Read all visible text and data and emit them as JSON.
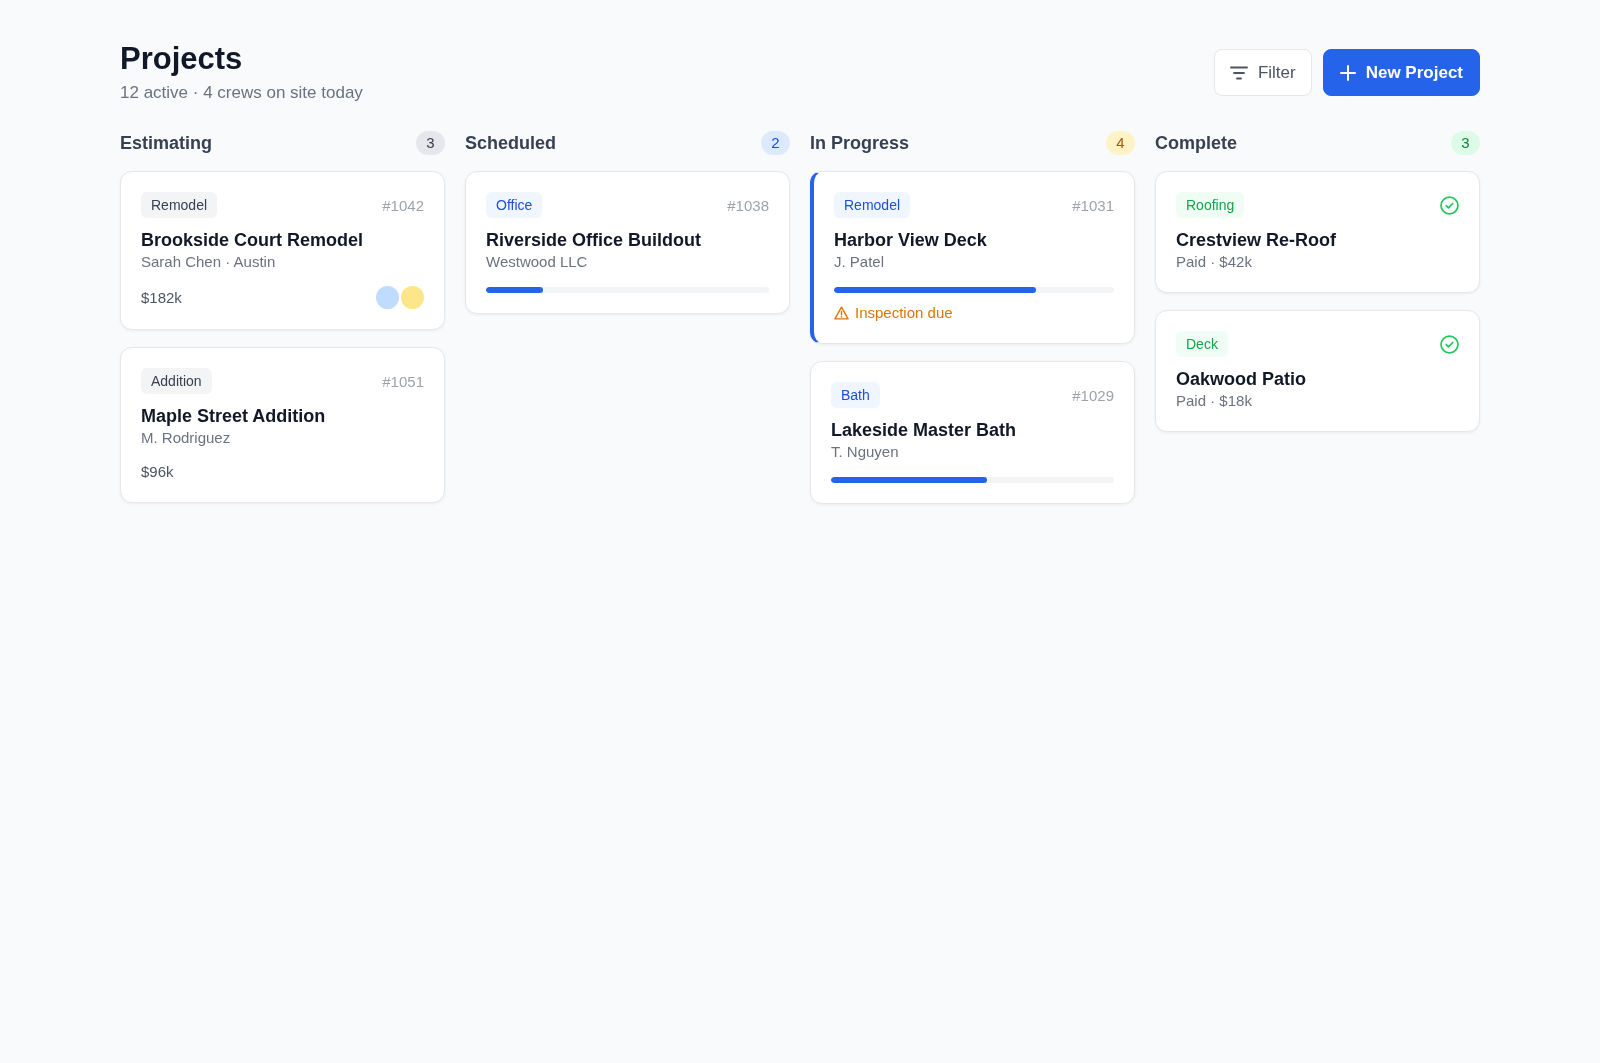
{
  "header": {
    "title": "Projects",
    "subtitle": "12 active · 4 crews on site today"
  },
  "actions": [
    {
      "kind": "secondary",
      "label": "Filter"
    },
    {
      "kind": "primary",
      "label": "New Project"
    }
  ],
  "columns": [
    {
      "title": "Estimating",
      "count": "3",
      "kind": "neutral",
      "cards": [
        {
          "tag": {
            "label": "Remodel",
            "kind": "neutral"
          },
          "number": "#1042",
          "done": false,
          "selected": false,
          "title": "Brookside Court Remodel",
          "subtitle": "Sarah Chen · Austin",
          "value": "$182k",
          "avatars": [
            {
              "color": "#bfdbfe"
            },
            {
              "color": "#fde68a"
            }
          ]
        },
        {
          "tag": {
            "label": "Addition",
            "kind": "neutral"
          },
          "number": "#1051",
          "done": false,
          "selected": false,
          "title": "Maple Street Addition",
          "subtitle": "M. Rodriguez",
          "value": "$96k"
        }
      ]
    },
    {
      "title": "Scheduled",
      "count": "2",
      "kind": "blue",
      "cards": [
        {
          "tag": {
            "label": "Office",
            "kind": "blue"
          },
          "number": "#1038",
          "done": false,
          "selected": false,
          "title": "Riverside Office Buildout",
          "subtitle": "Westwood LLC",
          "level": 0.2
        }
      ]
    },
    {
      "title": "In Progress",
      "count": "4",
      "kind": "amber",
      "cards": [
        {
          "tag": {
            "label": "Remodel",
            "kind": "blue"
          },
          "number": "#1031",
          "done": false,
          "selected": true,
          "title": "Harbor View Deck",
          "subtitle": "J. Patel",
          "level": 0.72,
          "alert": "Inspection due"
        },
        {
          "tag": {
            "label": "Bath",
            "kind": "blue"
          },
          "number": "#1029",
          "done": false,
          "selected": false,
          "title": "Lakeside Master Bath",
          "subtitle": "T. Nguyen",
          "level": 0.55
        }
      ]
    },
    {
      "title": "Complete",
      "count": "3",
      "kind": "green",
      "cards": [
        {
          "tag": {
            "label": "Roofing",
            "kind": "green"
          },
          "done": true,
          "selected": false,
          "title": "Crestview Re-Roof",
          "subtitle": "Paid · $42k"
        },
        {
          "tag": {
            "label": "Deck",
            "kind": "green"
          },
          "done": true,
          "selected": false,
          "title": "Oakwood Patio",
          "subtitle": "Paid · $18k"
        }
      ]
    }
  ]
}
